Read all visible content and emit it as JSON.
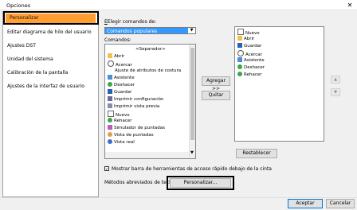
{
  "window": {
    "title": "Opciones",
    "close": "✕"
  },
  "nav": [
    "Personalizar",
    "Editar diagrama de hilo del usuario",
    "Ajustes DST",
    "Unidad del sistema",
    "Calibración de la pantalla",
    "Ajustes de la interfaz de usuario"
  ],
  "choose_label": "Elegir comandos de:",
  "combo_value": "Comandos populares",
  "commands_label": "Comandos:",
  "commands": [
    {
      "label": "<Separador>",
      "icon": "none"
    },
    {
      "label": "Abrir",
      "icon": "folder-icon"
    },
    {
      "label": "Acercar",
      "icon": "zoom-in-icon"
    },
    {
      "label": "Ajuste de atributos de costura",
      "icon": "none"
    },
    {
      "label": "Asistente",
      "icon": "wizard-icon"
    },
    {
      "label": "Deshacer",
      "icon": "undo-icon"
    },
    {
      "label": "Guardar",
      "icon": "save-icon"
    },
    {
      "label": "Imprimir configuración",
      "icon": "print-setup-icon"
    },
    {
      "label": "Imprimir vista previa",
      "icon": "print-preview-icon"
    },
    {
      "label": "Nuevo",
      "icon": "new-file-icon"
    },
    {
      "label": "Rehacer",
      "icon": "redo-icon"
    },
    {
      "label": "Simulador de puntadas",
      "icon": "simulator-icon"
    },
    {
      "label": "Vista de puntadas",
      "icon": "stitch-view-icon"
    },
    {
      "label": "Vista real",
      "icon": "real-view-icon"
    }
  ],
  "add_button": "Agregar >>",
  "remove_button": "Quitar",
  "toolbar_items": [
    {
      "label": "Nuevo",
      "icon": "new-file-icon"
    },
    {
      "label": "Abrir",
      "icon": "folder-icon"
    },
    {
      "label": "Guardar",
      "icon": "save-icon"
    },
    {
      "label": "Acercar",
      "icon": "zoom-in-icon"
    },
    {
      "label": "Asistente",
      "icon": "wizard-icon"
    },
    {
      "label": "Deshacer",
      "icon": "undo-icon"
    },
    {
      "label": "Rehacer",
      "icon": "redo-icon"
    }
  ],
  "reset_button": "Restablecer",
  "show_below_label": "Mostrar barra de herramientas de acceso rápido debajo de la cinta",
  "show_below_checked": true,
  "shortcuts_label": "Métodos abreviados de teclado:",
  "customize_button": "Personalizar...",
  "ok_button": "Aceptar",
  "cancel_button": "Cancelar"
}
